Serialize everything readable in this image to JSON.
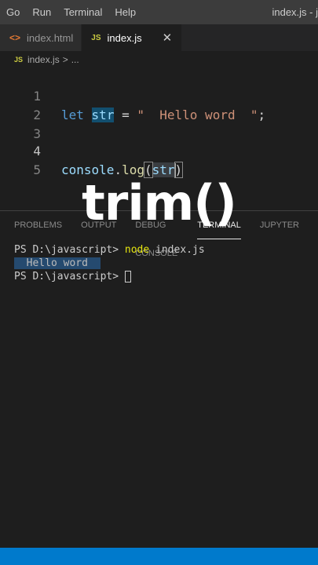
{
  "menubar": {
    "items": [
      "Go",
      "Run",
      "Terminal",
      "Help"
    ],
    "window_title": "index.js - j"
  },
  "tabs": [
    {
      "label": "index.html",
      "icon": "<>",
      "active": false
    },
    {
      "label": "index.js",
      "icon": "JS",
      "active": true,
      "close": "✕"
    }
  ],
  "breadcrumb": {
    "icon": "JS",
    "file": "index.js",
    "sep": ">",
    "more": "..."
  },
  "editor": {
    "line_numbers": [
      "1",
      "2",
      "3",
      "4",
      "5"
    ],
    "line1": {
      "kw": "let",
      "var": "str",
      "op": " = ",
      "str": "\"  Hello word  \"",
      "end": ";"
    },
    "line4": {
      "obj": "console",
      "dot": ".",
      "fn": "log",
      "open": "(",
      "arg_a": "str",
      "close": ")"
    }
  },
  "overlay": {
    "title": "trim()"
  },
  "panel": {
    "tabs": [
      "PROBLEMS",
      "OUTPUT",
      "DEBUG CONSOLE",
      "TERMINAL",
      "JUPYTER"
    ],
    "active_tab": "TERMINAL"
  },
  "terminal": {
    "prompt": "PS D:\\javascript> ",
    "command": "node",
    "command_arg": " index.js",
    "output_lead": "  ",
    "output_text": "Hello word",
    "output_trail": "  ",
    "prompt2": "PS D:\\javascript> "
  },
  "colors": {
    "statusbar": "#007acc",
    "editor_bg": "#1e1e1e",
    "keyword": "#569cd6",
    "string": "#ce9178",
    "function": "#dcdcaa"
  }
}
